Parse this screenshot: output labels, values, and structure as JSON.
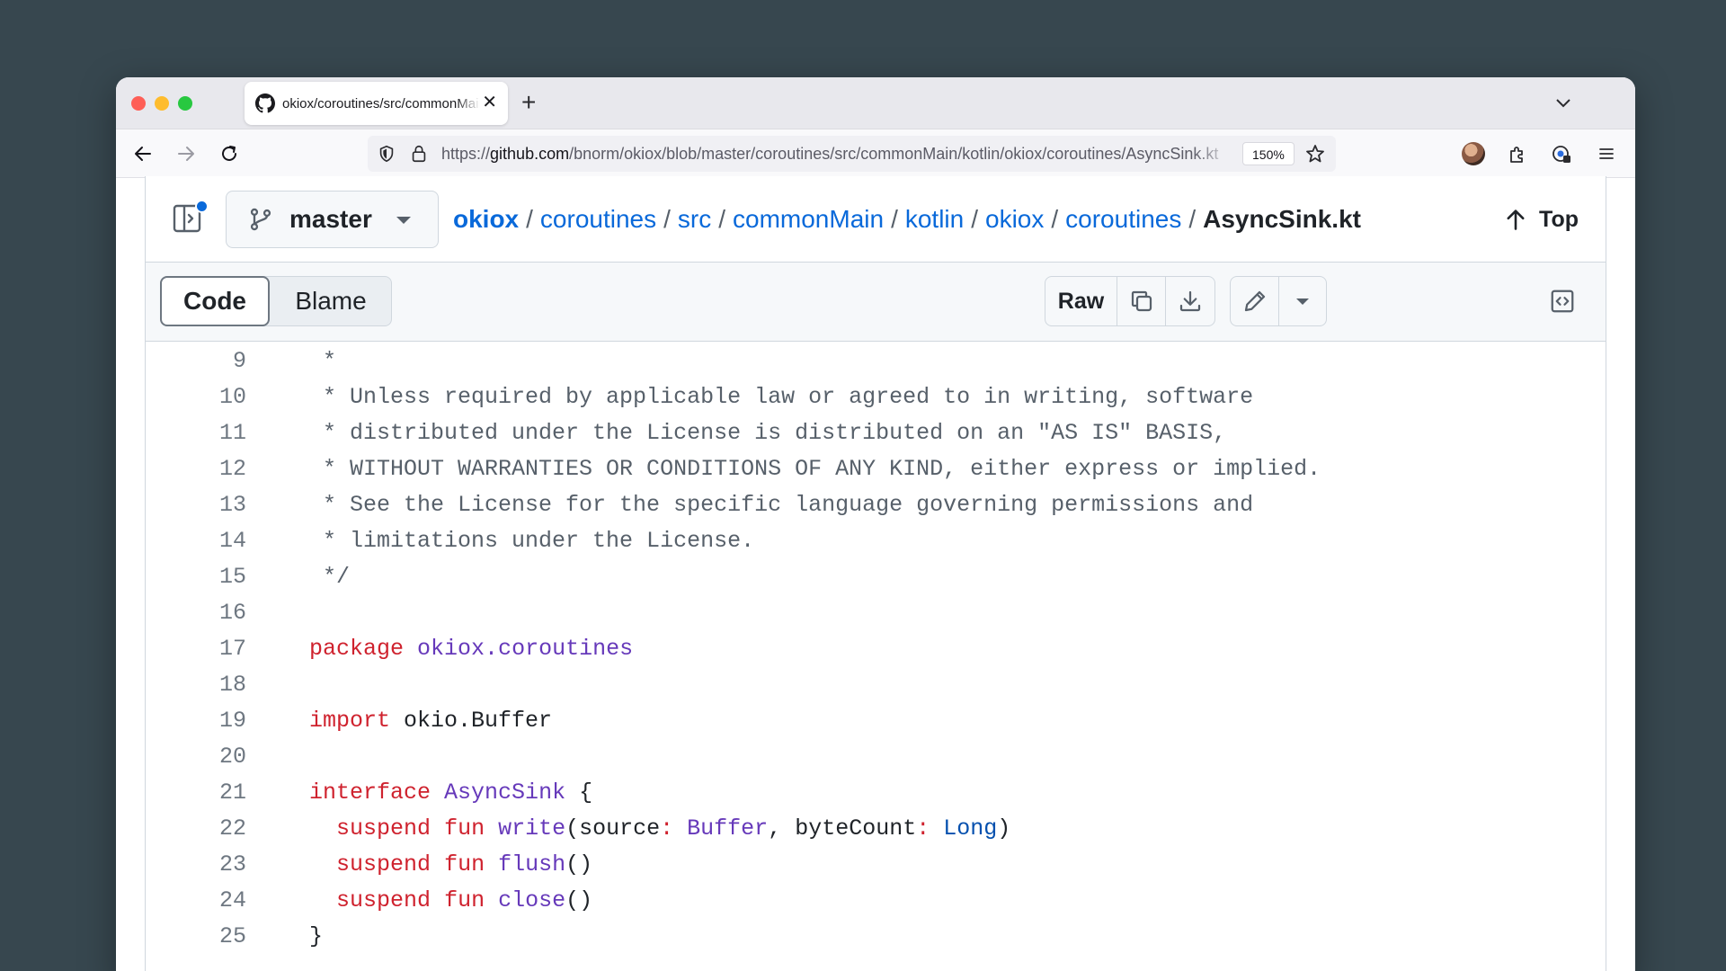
{
  "browser": {
    "tab": {
      "title": "okiox/coroutines/src/commonMain/kotlin/okiox/coroutines/AsyncSink.kt"
    },
    "url": {
      "prefix": "https://",
      "host": "github.com",
      "path": "/bnorm/okiox/blob/master/coroutines/src/commonMain/kotlin/okiox/coroutines/AsyncSink.kt"
    },
    "zoom": "150%"
  },
  "file_header": {
    "branch": "master",
    "breadcrumb": [
      "okiox",
      "coroutines",
      "src",
      "commonMain",
      "kotlin",
      "okiox",
      "coroutines"
    ],
    "current_file": "AsyncSink.kt",
    "separator": "/",
    "top_label": "Top"
  },
  "toolbar": {
    "code_label": "Code",
    "blame_label": "Blame",
    "raw_label": "Raw"
  },
  "code_lines": [
    {
      "n": "9",
      "tokens": [
        [
          "cm",
          " *"
        ]
      ]
    },
    {
      "n": "10",
      "tokens": [
        [
          "cm",
          " * Unless required by applicable law or agreed to in writing, software"
        ]
      ]
    },
    {
      "n": "11",
      "tokens": [
        [
          "cm",
          " * distributed under the License is distributed on an \"AS IS\" BASIS,"
        ]
      ]
    },
    {
      "n": "12",
      "tokens": [
        [
          "cm",
          " * WITHOUT WARRANTIES OR CONDITIONS OF ANY KIND, either express or implied."
        ]
      ]
    },
    {
      "n": "13",
      "tokens": [
        [
          "cm",
          " * See the License for the specific language governing permissions and"
        ]
      ]
    },
    {
      "n": "14",
      "tokens": [
        [
          "cm",
          " * limitations under the License."
        ]
      ]
    },
    {
      "n": "15",
      "tokens": [
        [
          "cm",
          " */"
        ]
      ]
    },
    {
      "n": "16",
      "tokens": []
    },
    {
      "n": "17",
      "tokens": [
        [
          "kw",
          "package"
        ],
        [
          "",
          " "
        ],
        [
          "ty",
          "okiox.coroutines"
        ]
      ]
    },
    {
      "n": "18",
      "tokens": []
    },
    {
      "n": "19",
      "tokens": [
        [
          "kw",
          "import"
        ],
        [
          "",
          " okio.Buffer"
        ]
      ]
    },
    {
      "n": "20",
      "tokens": []
    },
    {
      "n": "21",
      "tokens": [
        [
          "kw",
          "interface"
        ],
        [
          "",
          " "
        ],
        [
          "ty",
          "AsyncSink"
        ],
        [
          "",
          " {"
        ]
      ]
    },
    {
      "n": "22",
      "tokens": [
        [
          "",
          "  "
        ],
        [
          "kw",
          "suspend"
        ],
        [
          "",
          " "
        ],
        [
          "kw",
          "fun"
        ],
        [
          "",
          " "
        ],
        [
          "fn",
          "write"
        ],
        [
          "",
          "(source"
        ],
        [
          "kw",
          ":"
        ],
        [
          "",
          " "
        ],
        [
          "ty",
          "Buffer"
        ],
        [
          "",
          ", byteCount"
        ],
        [
          "kw",
          ":"
        ],
        [
          "",
          " "
        ],
        [
          "bl",
          "Long"
        ],
        [
          "",
          ")"
        ]
      ]
    },
    {
      "n": "23",
      "tokens": [
        [
          "",
          "  "
        ],
        [
          "kw",
          "suspend"
        ],
        [
          "",
          " "
        ],
        [
          "kw",
          "fun"
        ],
        [
          "",
          " "
        ],
        [
          "fn",
          "flush"
        ],
        [
          "",
          "()"
        ]
      ]
    },
    {
      "n": "24",
      "tokens": [
        [
          "",
          "  "
        ],
        [
          "kw",
          "suspend"
        ],
        [
          "",
          " "
        ],
        [
          "kw",
          "fun"
        ],
        [
          "",
          " "
        ],
        [
          "fn",
          "close"
        ],
        [
          "",
          "()"
        ]
      ]
    },
    {
      "n": "25",
      "tokens": [
        [
          "",
          "}"
        ]
      ]
    }
  ]
}
